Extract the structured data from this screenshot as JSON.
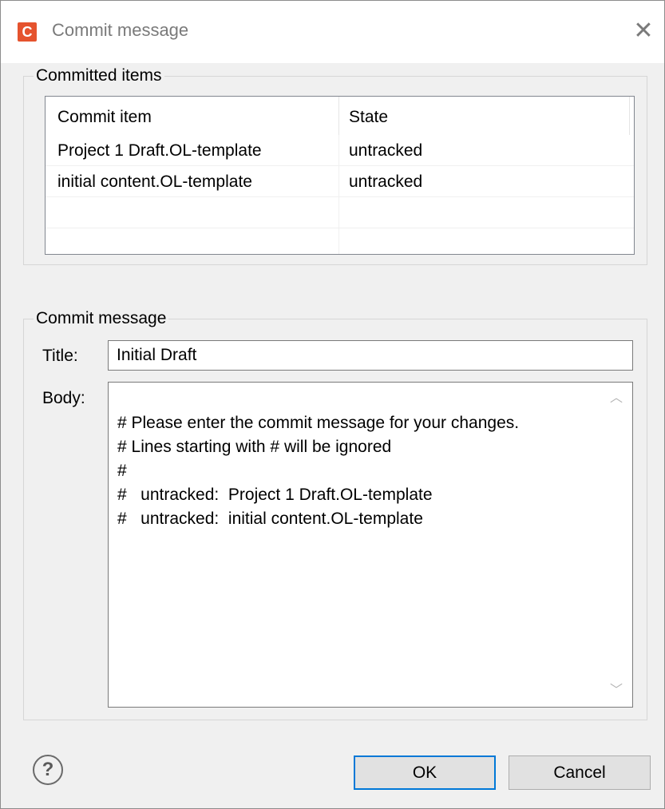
{
  "window": {
    "title": "Commit message",
    "app_logo_letter": "C",
    "close_glyph": "✕"
  },
  "committed_items": {
    "legend": "Committed items",
    "columns": [
      "Commit item",
      "State"
    ],
    "rows": [
      {
        "item": "Project 1 Draft.OL-template",
        "state": "untracked"
      },
      {
        "item": "initial content.OL-template",
        "state": "untracked"
      },
      {
        "item": "",
        "state": ""
      },
      {
        "item": "",
        "state": ""
      }
    ]
  },
  "commit_message": {
    "legend": "Commit message",
    "title_label": "Title:",
    "title_value": "Initial Draft",
    "body_label": "Body:",
    "body_value": "# Please enter the commit message for your changes.\n# Lines starting with # will be ignored\n#\n#   untracked:  Project 1 Draft.OL-template\n#   untracked:  initial content.OL-template"
  },
  "buttons": {
    "help": "?",
    "ok": "OK",
    "cancel": "Cancel"
  },
  "colors": {
    "accent": "#0078d7",
    "logo": "#e5532e"
  }
}
